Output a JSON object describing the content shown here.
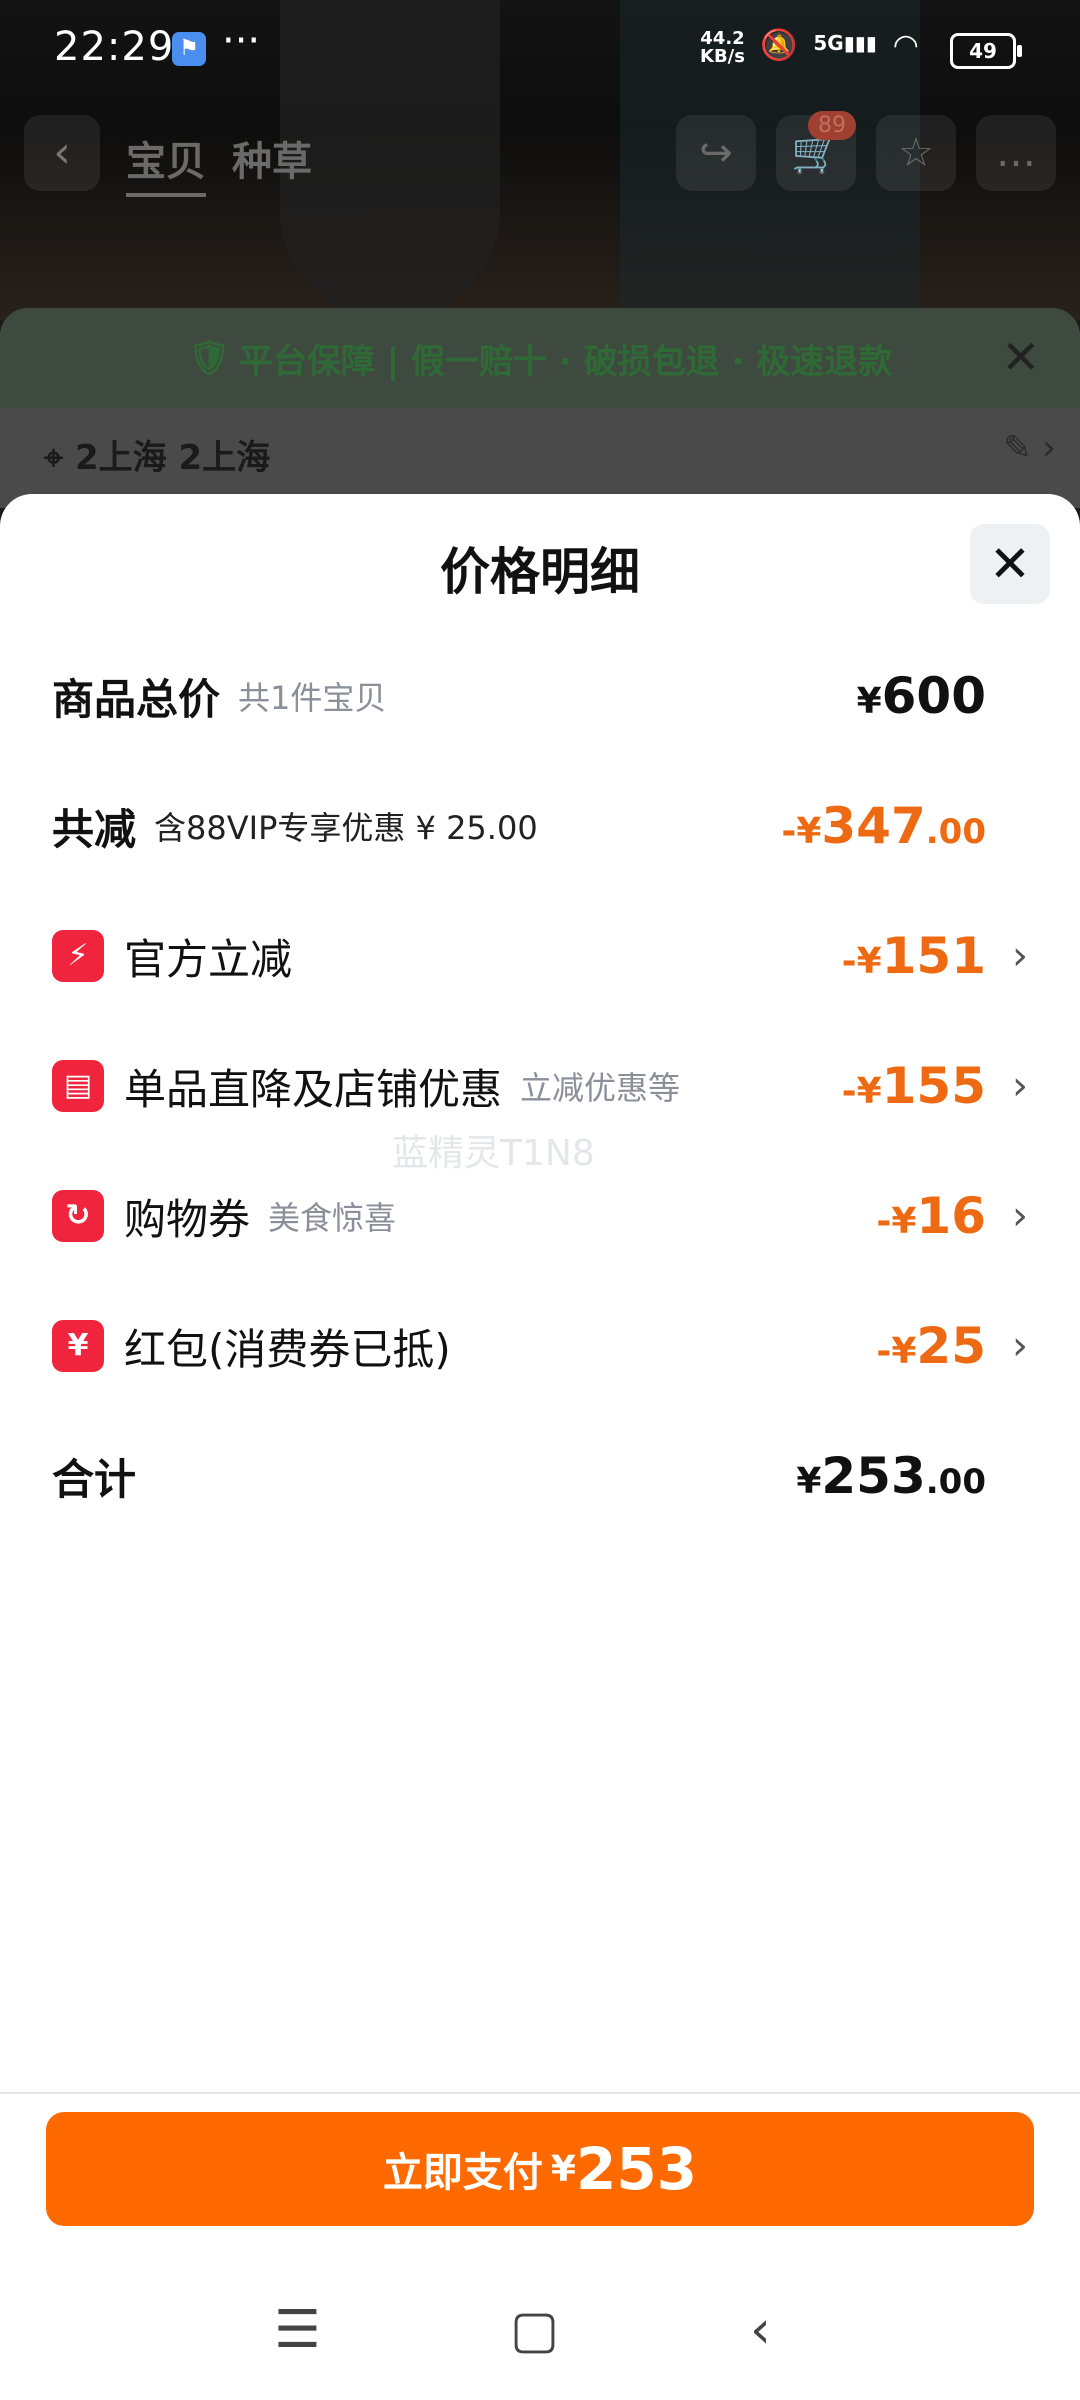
{
  "status_bar": {
    "time": "22:29",
    "net_speed_top": "44.2",
    "net_speed_unit": "KB/s",
    "network": "5G",
    "battery": "49"
  },
  "header": {
    "tab_1": "宝贝",
    "tab_2": "种草",
    "cart_count": "89"
  },
  "background": {
    "guarantee": "平台保障 | 假一赔十 · 破损包退 · 极速退款",
    "address": "2上海 2上海"
  },
  "sheet": {
    "title": "价格明细",
    "rows": [
      {
        "label": "商品总价",
        "sub": "共1件宝贝",
        "yen": "¥",
        "amount": "600",
        "cents": ""
      },
      {
        "label": "共减",
        "sub": "含88VIP专享优惠 ¥ 25.00",
        "yen": "-¥",
        "amount": "347",
        "cents": ".00"
      },
      {
        "label": "官方立减",
        "sub": "",
        "yen": "-¥",
        "amount": "151",
        "cents": ""
      },
      {
        "label": "单品直降及店铺优惠",
        "sub": "立减优惠等",
        "yen": "-¥",
        "amount": "155",
        "cents": ""
      },
      {
        "label": "购物券",
        "sub": "美食惊喜",
        "yen": "-¥",
        "amount": "16",
        "cents": ""
      },
      {
        "label": "红包(消费券已抵)",
        "sub": "",
        "yen": "-¥",
        "amount": "25",
        "cents": ""
      },
      {
        "label": "合计",
        "sub": "",
        "yen": "¥",
        "amount": "253",
        "cents": ".00"
      }
    ],
    "watermark": "蓝精灵T1N8"
  },
  "pay_button": {
    "label": "立即支付",
    "yen": "¥",
    "amount": "253"
  },
  "colors": {
    "accent": "#ff6a00",
    "discount": "#ee6a12",
    "icon_red": "#f0243c"
  }
}
